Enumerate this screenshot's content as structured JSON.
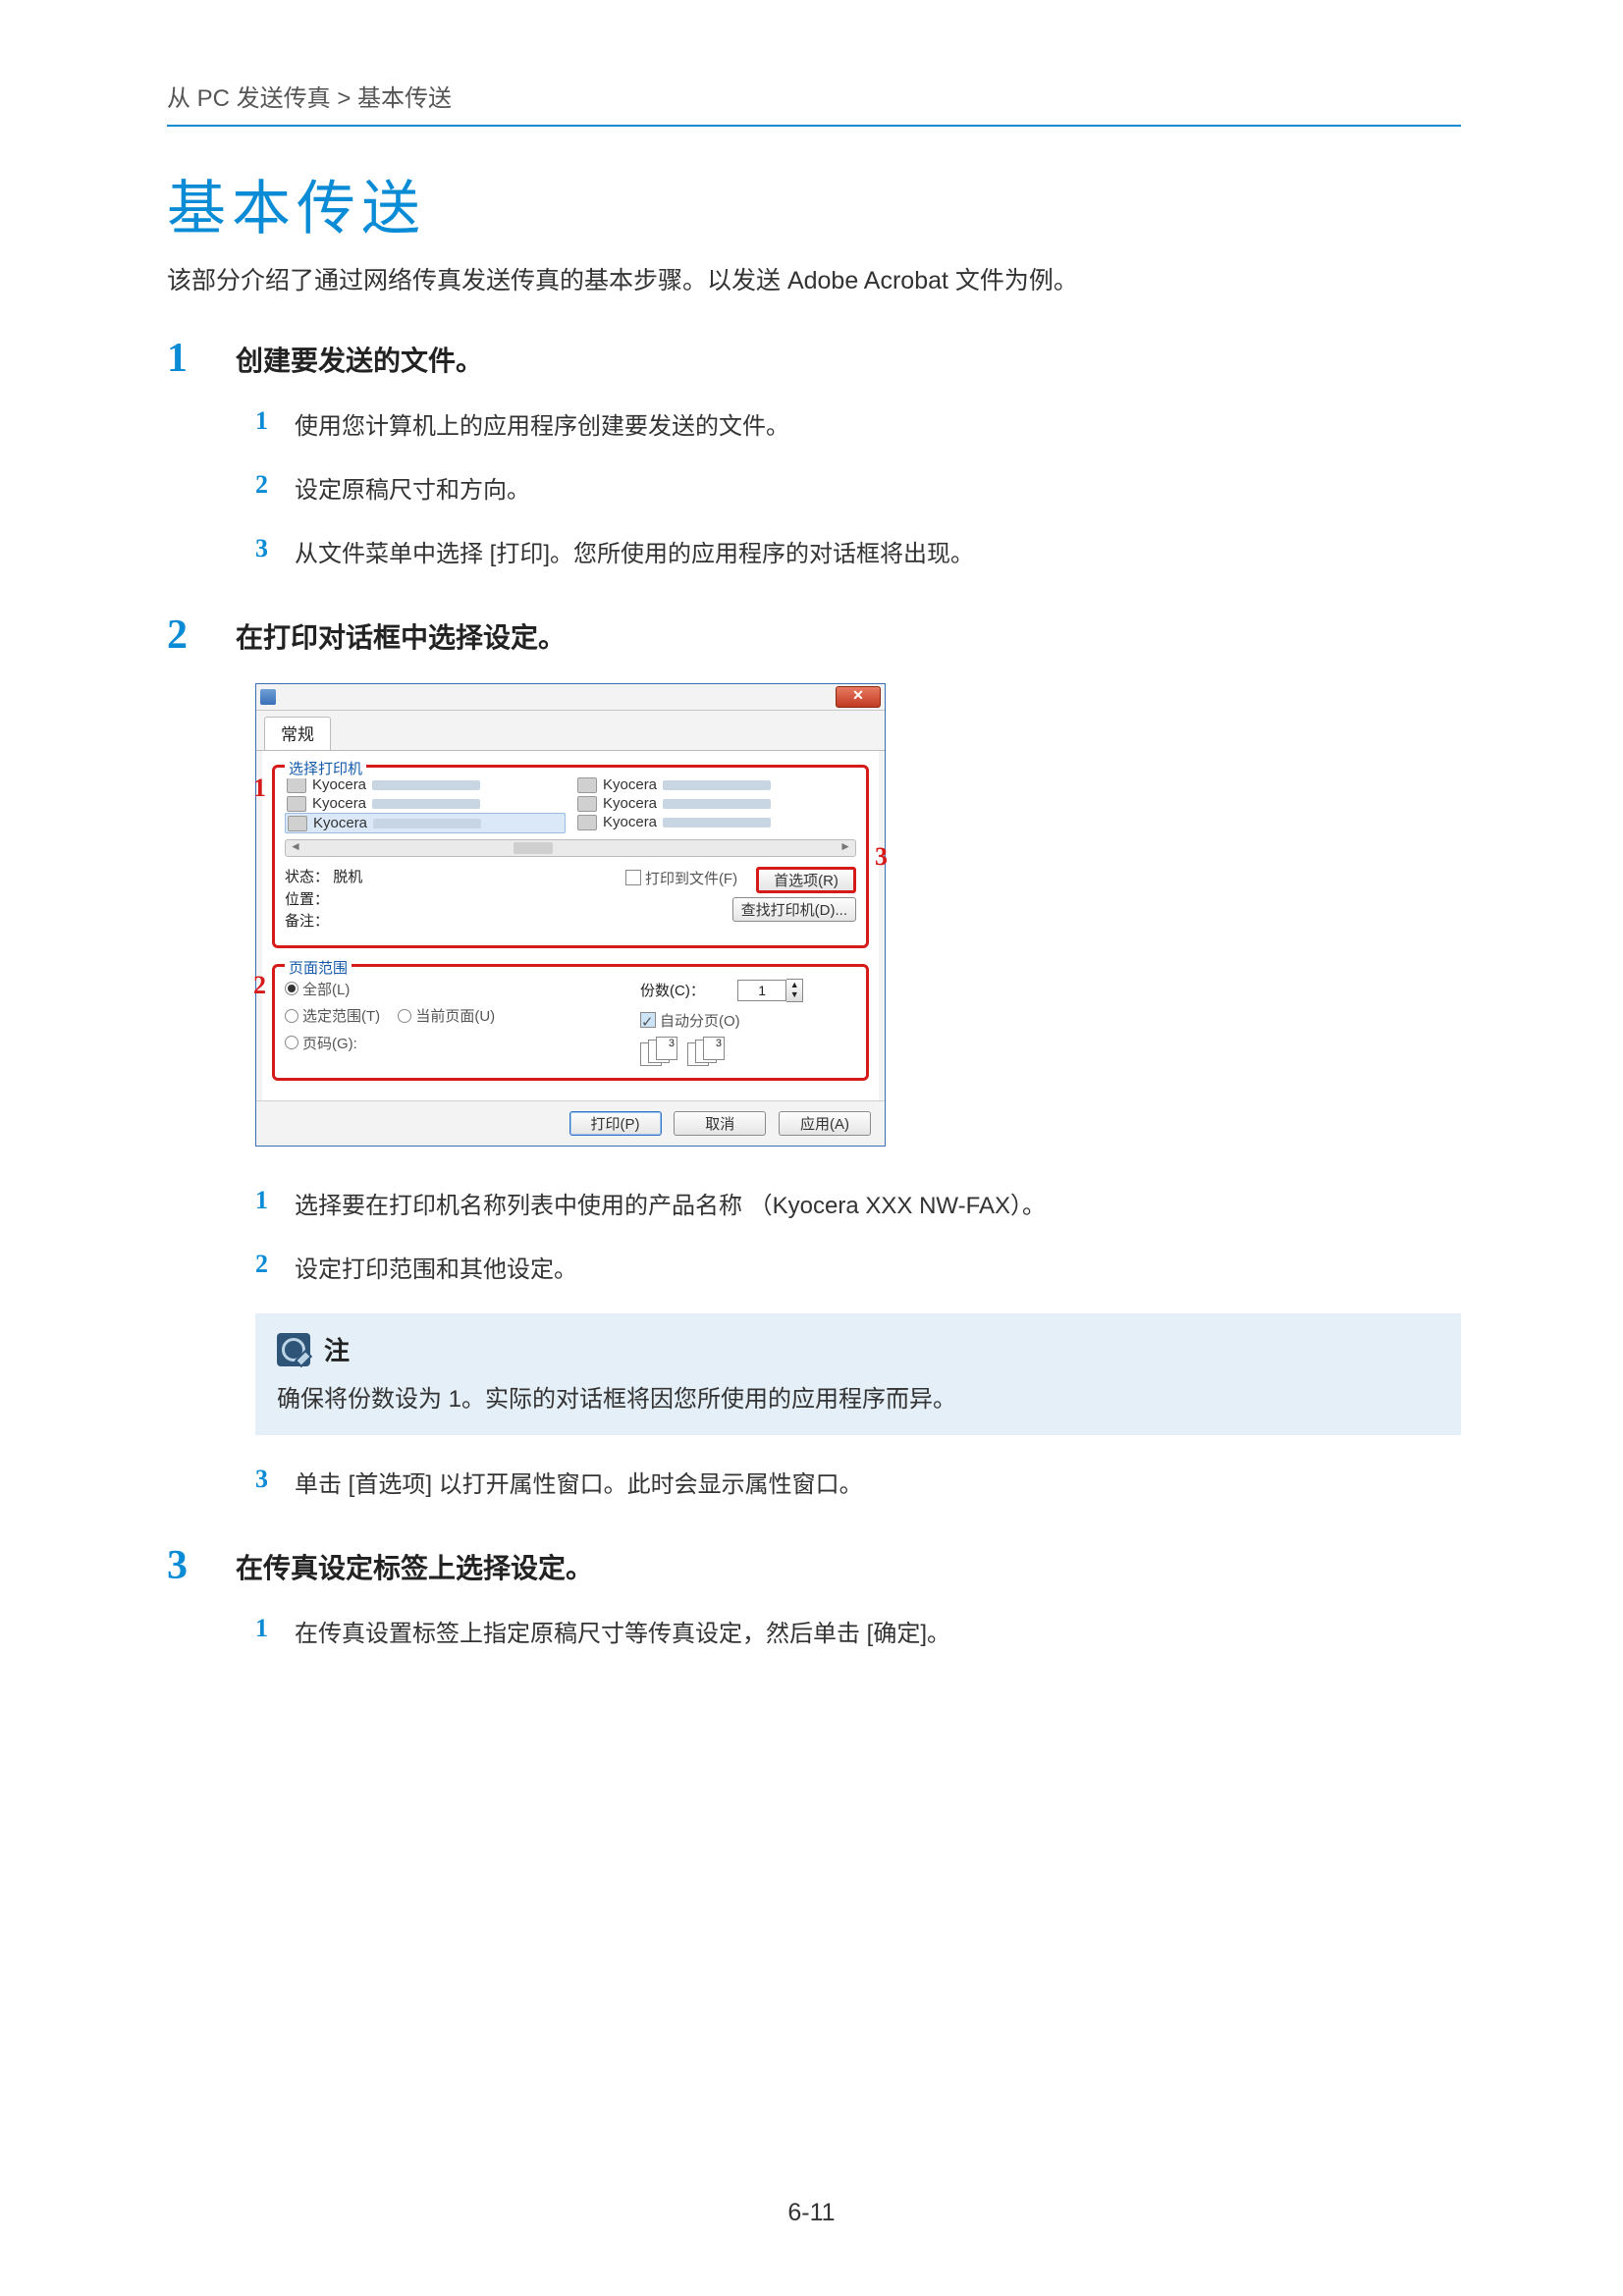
{
  "breadcrumb": "从 PC 发送传真 > 基本传送",
  "title": "基本传送",
  "intro": "该部分介绍了通过网络传真发送传真的基本步骤。以发送 Adobe Acrobat 文件为例。",
  "steps": {
    "s1": {
      "num": "1",
      "heading": "创建要发送的文件。",
      "subs": {
        "a": {
          "num": "1",
          "text": "使用您计算机上的应用程序创建要发送的文件。"
        },
        "b": {
          "num": "2",
          "text": "设定原稿尺寸和方向。"
        },
        "c": {
          "num": "3",
          "text": "从文件菜单中选择 [打印]。您所使用的应用程序的对话框将出现。"
        }
      }
    },
    "s2": {
      "num": "2",
      "heading": "在打印对话框中选择设定。",
      "subs": {
        "a": {
          "num": "1",
          "text": "选择要在打印机名称列表中使用的产品名称 （Kyocera XXX NW-FAX）。"
        },
        "b": {
          "num": "2",
          "text": "设定打印范围和其他设定。"
        },
        "c": {
          "num": "3",
          "text": "单击 [首选项] 以打开属性窗口。此时会显示属性窗口。"
        }
      },
      "note": {
        "title": "注",
        "text": "确保将份数设为 1。实际的对话框将因您所使用的应用程序而异。"
      }
    },
    "s3": {
      "num": "3",
      "heading": "在传真设定标签上选择设定。",
      "subs": {
        "a": {
          "num": "1",
          "text": "在传真设置标签上指定原稿尺寸等传真设定，然后单击 [确定]。"
        }
      }
    }
  },
  "dialog": {
    "close_glyph": "✕",
    "tab_general": "常规",
    "grp_select_printer": "选择打印机",
    "printer_name": "Kyocera",
    "status_label": "状态：",
    "status_value": "脱机",
    "location_label": "位置：",
    "comment_label": "备注：",
    "chk_print_to_file": "打印到文件(F)",
    "btn_preferences": "首选项(R)",
    "btn_find_printer": "查找打印机(D)...",
    "grp_page_range": "页面范围",
    "rad_all": "全部(L)",
    "rad_selection": "选定范围(T)",
    "rad_current": "当前页面(U)",
    "rad_pages": "页码(G):",
    "copies_label": "份数(C)：",
    "copies_value": "1",
    "chk_collate": "自动分页(O)",
    "btn_print": "打印(P)",
    "btn_cancel": "取消",
    "btn_apply": "应用(A)",
    "callout1": "1",
    "callout2": "2",
    "callout3": "3"
  },
  "page_number": "6-11"
}
